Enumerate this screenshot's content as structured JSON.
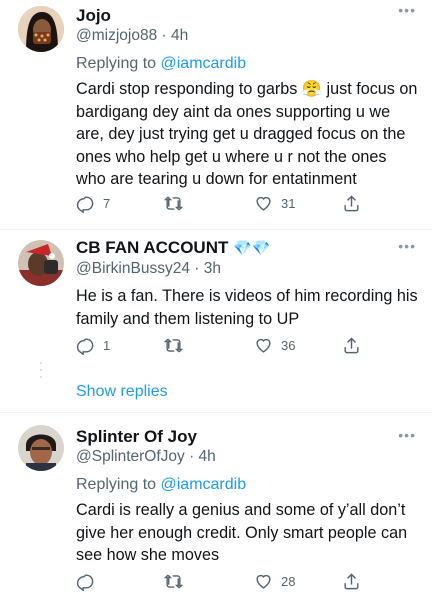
{
  "tweets": [
    {
      "name": "Jojo",
      "handle": "@mizjojo88",
      "time": "· 4h",
      "replying_prefix": "Replying to ",
      "replying_to": "@iamcardib",
      "text_part1": "Cardi stop responding to garbs ",
      "emoji": "😤",
      "text_part2": " just focus on bardigang dey aint da ones supporting u we are, dey just trying  get u dragged focus on the ones who help get u where u r not the ones who are tearing u down for entatinment",
      "replies": "7",
      "retweets": "",
      "likes": "31"
    },
    {
      "name": "CB FAN ACCOUNT",
      "badges": "💎💎",
      "handle": "@BirkinBussy24",
      "time": "· 3h",
      "text": "He is a fan. There is videos of him recording his family and them listening to UP",
      "replies": "1",
      "retweets": "",
      "likes": "36"
    },
    {
      "name": "Splinter Of Joy",
      "handle": "@SplinterOfJoy",
      "time": "· 4h",
      "replying_prefix": "Replying to ",
      "replying_to": "@iamcardib",
      "text": "Cardi is really a genius and some of y’all don’t give her enough credit. Only smart people can see how she moves",
      "replies": "",
      "retweets": "",
      "likes": "28"
    }
  ],
  "thread": {
    "show_replies": "Show replies"
  },
  "ui": {
    "more": "•••"
  },
  "icons": {
    "reply": "reply-icon",
    "retweet": "retweet-icon",
    "like": "heart-icon",
    "share": "share-icon"
  },
  "colors": {
    "accent": "#1d9bf0",
    "secondary_text": "#536471"
  }
}
